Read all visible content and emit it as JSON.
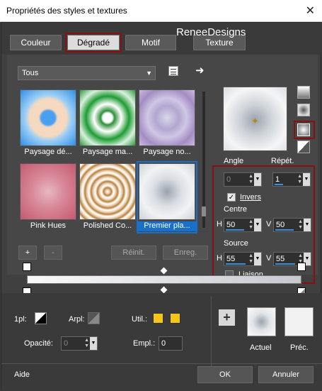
{
  "window": {
    "title": "Propriétés des styles et textures",
    "close": "✕"
  },
  "brand": "ReneeDesigns",
  "tabs": [
    {
      "label": "Couleur"
    },
    {
      "label": "Dégradé"
    },
    {
      "label": "Motif"
    },
    {
      "label": "Texture"
    }
  ],
  "category": {
    "selected": "Tous"
  },
  "gradients": [
    {
      "label": "Paysage dé..."
    },
    {
      "label": "Paysage ma..."
    },
    {
      "label": "Paysage no..."
    },
    {
      "label": "Pink Hues"
    },
    {
      "label": "Polished Co..."
    },
    {
      "label": "Premier pla..."
    }
  ],
  "list_buttons": {
    "add": "+",
    "remove": "-",
    "reset": "Réinit.",
    "save": "Enreg."
  },
  "params": {
    "angle_label": "Angle",
    "angle": "0",
    "repeat_label": "Répét.",
    "repeat": "1",
    "invert_label": "Invers",
    "invert": true,
    "center_label": "Centre",
    "center_h": "50",
    "center_v": "50",
    "source_label": "Source",
    "source_h": "55",
    "source_v": "55",
    "link_label": "Liaison",
    "link": false,
    "h": "H",
    "v": "V"
  },
  "bottom": {
    "fpl": "1pl:",
    "arpl": "Arpl:",
    "util": "Util.:",
    "opacity_label": "Opacité:",
    "opacity": "0",
    "empl_label": "Empl.:",
    "empl": "0",
    "actual": "Actuel",
    "previous": "Préc."
  },
  "footer": {
    "help": "Aide",
    "ok": "OK",
    "cancel": "Annuler"
  },
  "colors": {
    "accent": "#1a6fc9",
    "highlight": "#8a1010",
    "swatch": "#f5c518"
  }
}
